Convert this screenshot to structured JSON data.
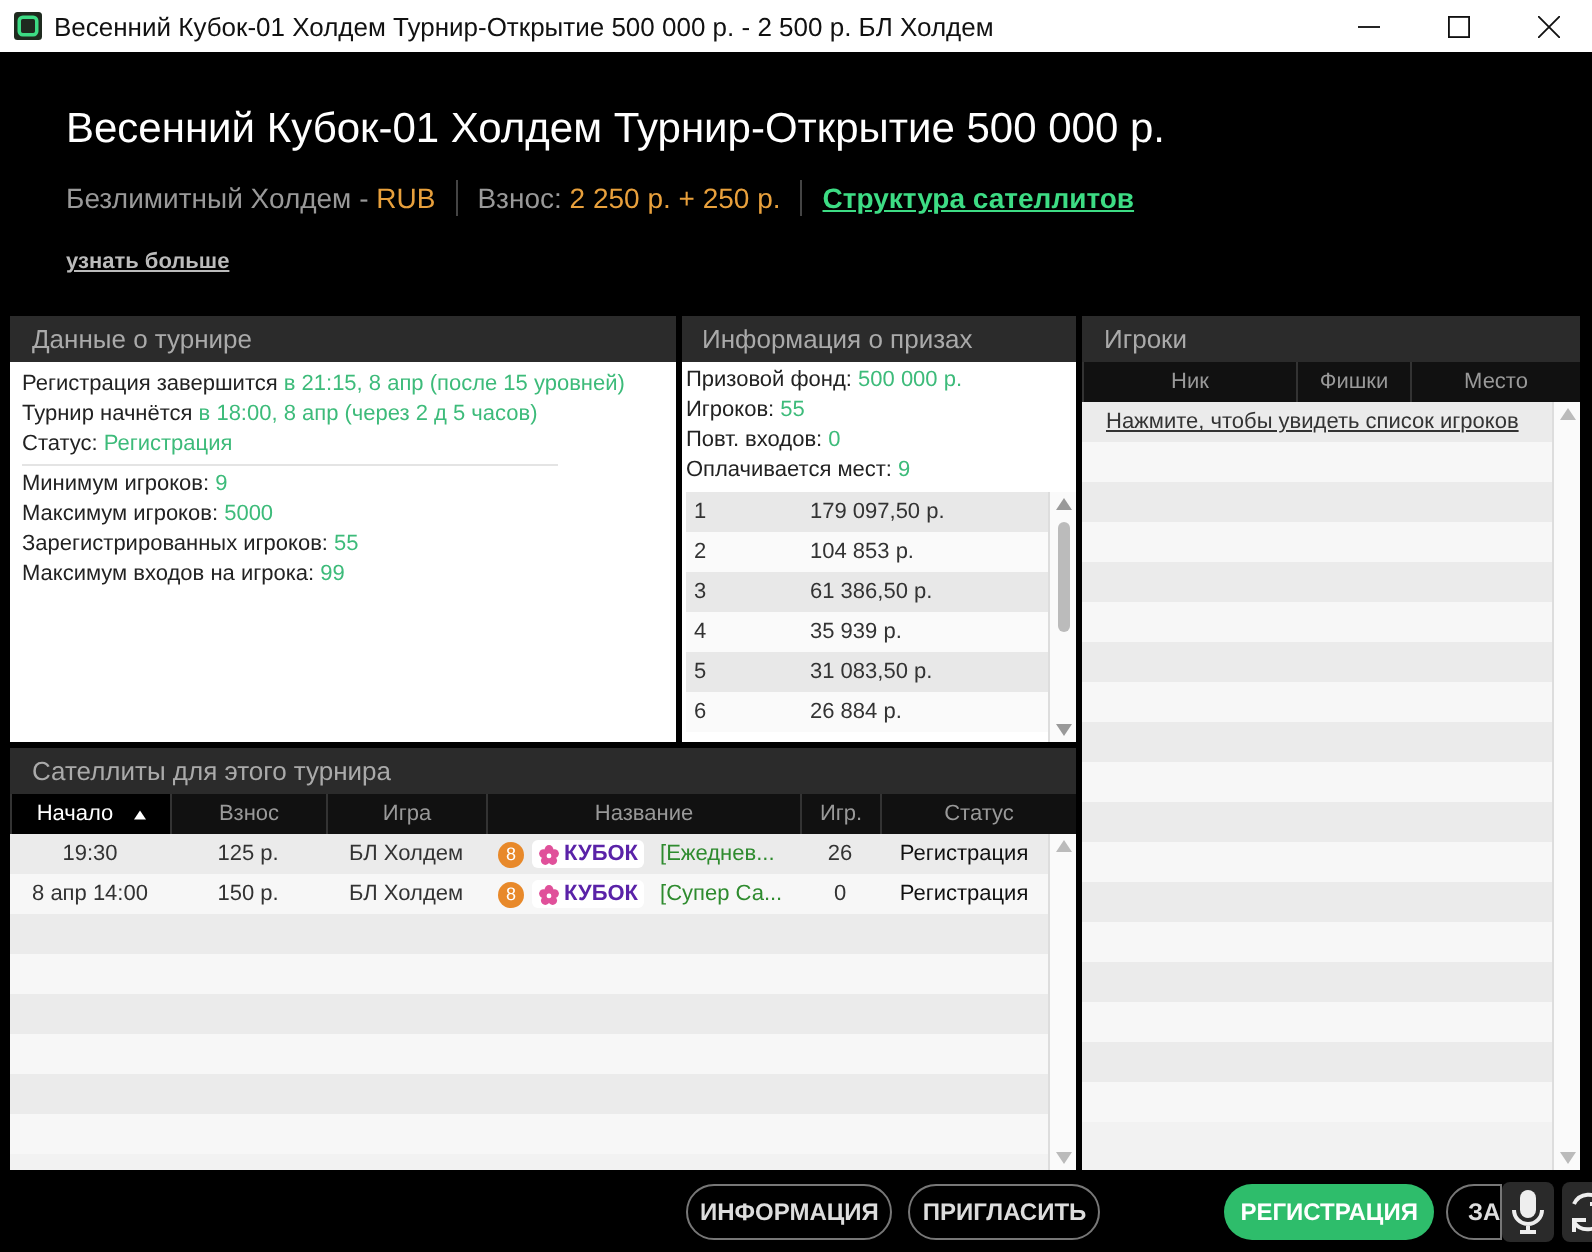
{
  "window": {
    "title": "Весенний Кубок-01 Холдем Турнир-Открытие 500 000 р. - 2 500 р. БЛ Холдем"
  },
  "header": {
    "title": "Весенний Кубок-01 Холдем Турнир-Открытие 500 000 р.",
    "game": "Безлимитный Холдем - ",
    "currency": "RUB",
    "buyin_label": "Взнос: ",
    "buyin": "2 250 р. + 250 р.",
    "link": "Структура сателлитов",
    "more": "узнать больше"
  },
  "tournament": {
    "title": "Данные о турнире",
    "lines": [
      {
        "label": "Регистрация завершится ",
        "value": "в 21:15, 8 апр (после 15 уровней)"
      },
      {
        "label": "Турнир начнётся ",
        "value": "в 18:00, 8 апр (через 2 д 5 часов)"
      },
      {
        "label": "Статус: ",
        "value": "Регистрация"
      }
    ],
    "limits": [
      {
        "label": "Минимум игроков: ",
        "value": "9"
      },
      {
        "label": "Максимум игроков: ",
        "value": "5000"
      },
      {
        "label": "Зарегистрированных игроков: ",
        "value": "55"
      },
      {
        "label": "Максимум входов на игрока: ",
        "value": "99"
      }
    ]
  },
  "prizes": {
    "title": "Информация о призах",
    "lines": [
      {
        "label": "Призовой фонд: ",
        "value": "500 000 р."
      },
      {
        "label": "Игроков: ",
        "value": "55"
      },
      {
        "label": "Повт. входов: ",
        "value": "0"
      },
      {
        "label": "Оплачивается мест: ",
        "value": "9"
      }
    ],
    "rows": [
      {
        "place": "1",
        "amount": "179 097,50 р."
      },
      {
        "place": "2",
        "amount": "104 853 р."
      },
      {
        "place": "3",
        "amount": "61 386,50 р."
      },
      {
        "place": "4",
        "amount": "35 939 р."
      },
      {
        "place": "5",
        "amount": "31 083,50 р."
      },
      {
        "place": "6",
        "amount": "26 884 р."
      }
    ]
  },
  "satellites": {
    "title": "Сателлиты для этого турнира",
    "columns": [
      {
        "label": "Начало",
        "sorted": true
      },
      {
        "label": "Взнос",
        "sorted": false
      },
      {
        "label": "Игра",
        "sorted": false
      },
      {
        "label": "Название",
        "sorted": false
      },
      {
        "label": "Игр.",
        "sorted": false
      },
      {
        "label": "Статус",
        "sorted": false
      }
    ],
    "rows": [
      {
        "start": "19:30",
        "buyin": "125 р.",
        "game": "БЛ Холдем",
        "badge": "8",
        "logo": "КУБОК",
        "name": "[Ежеднев...",
        "players": "26",
        "status": "Регистрация"
      },
      {
        "start": "8 апр 14:00",
        "buyin": "150 р.",
        "game": "БЛ Холдем",
        "badge": "8",
        "logo": "КУБОК",
        "name": "[Супер Са...",
        "players": "0",
        "status": "Регистрация"
      }
    ]
  },
  "players": {
    "title": "Игроки",
    "columns": [
      "Ник",
      "Фишки",
      "Место"
    ],
    "link": "Нажмите, чтобы увидеть список игроков"
  },
  "buttons": [
    {
      "label": "ИНФОРМАЦИЯ",
      "kind": "outline"
    },
    {
      "label": "ПРИГЛАСИТЬ",
      "kind": "outline"
    },
    {
      "label": "РЕГИСТРАЦИЯ",
      "kind": "primary"
    },
    {
      "label": "ЗА",
      "kind": "outline"
    }
  ]
}
